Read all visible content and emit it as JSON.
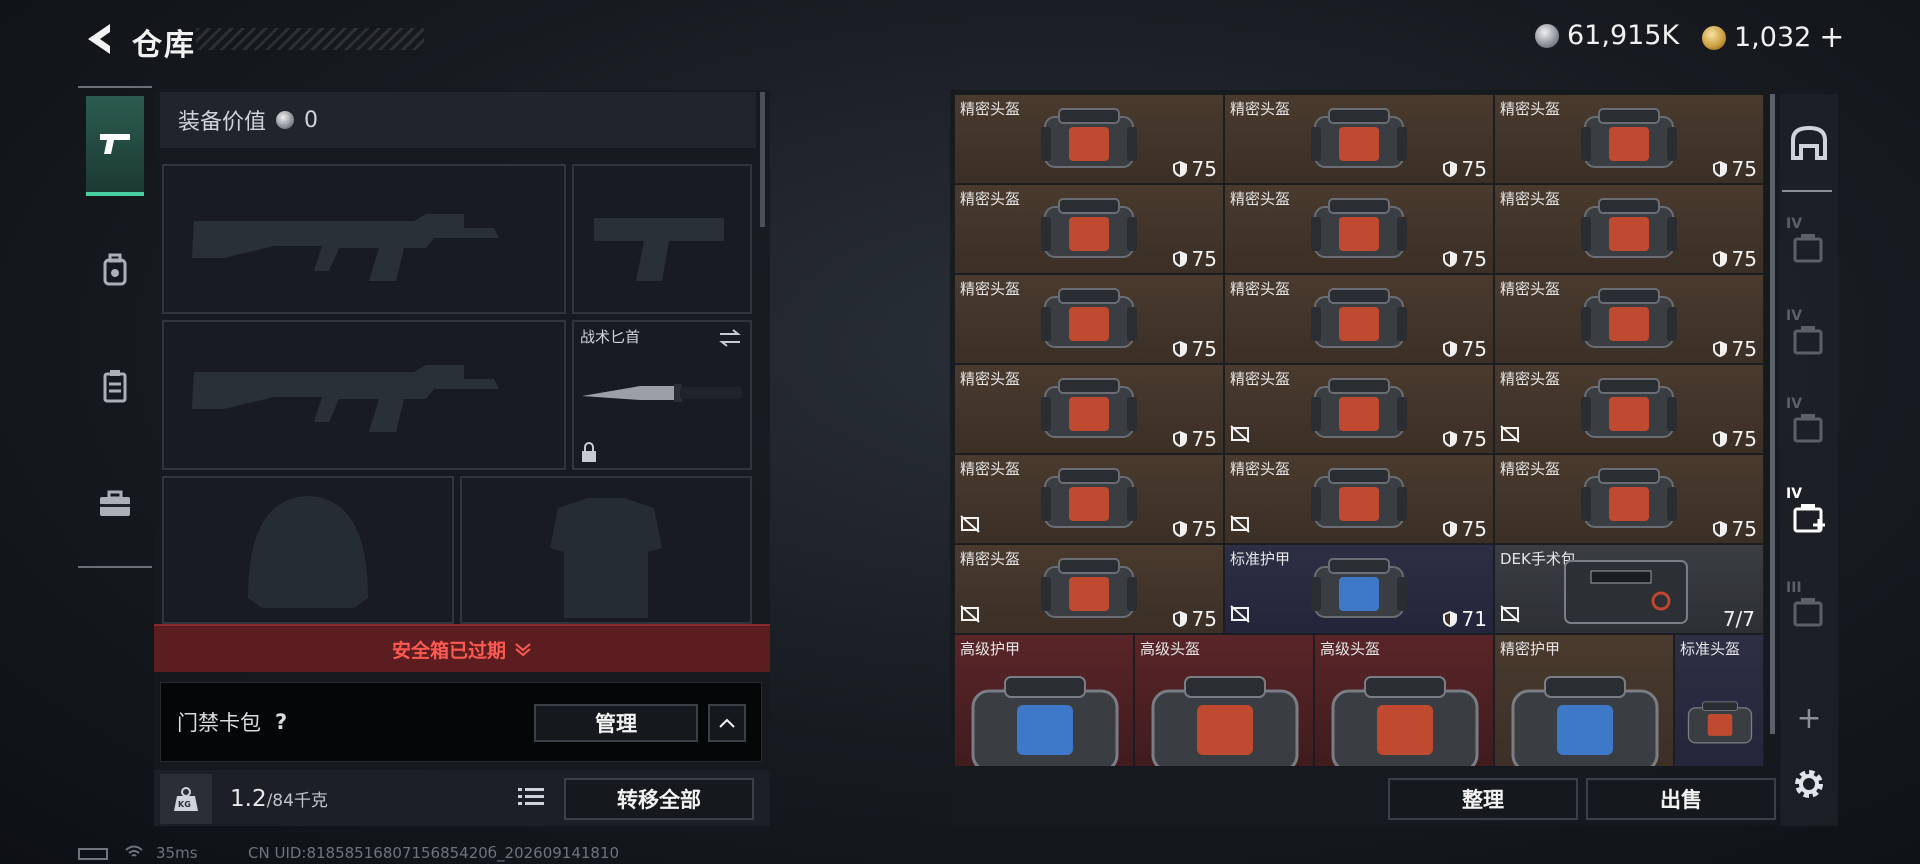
{
  "header": {
    "title": "仓库",
    "silver_amount": "61,915K",
    "gold_amount": "1,032",
    "gold_plus": "+"
  },
  "left": {
    "equip_value_label": "装备价值",
    "equip_value": "0",
    "melee_label": "战术匕首",
    "safebox_text": "安全箱已过期",
    "keycard_label": "门禁卡包",
    "keycard_help": "?",
    "manage_label": "管理",
    "weight_icon_text": "KG",
    "weight_current": "1.2",
    "weight_max": "/84千克",
    "transfer_all_label": "转移全部"
  },
  "inventory": {
    "items": [
      {
        "name": "精密头盔",
        "dur": "75",
        "color": "brown",
        "nosafe": false
      },
      {
        "name": "精密头盔",
        "dur": "75",
        "color": "brown",
        "nosafe": false
      },
      {
        "name": "精密头盔",
        "dur": "75",
        "color": "brown",
        "nosafe": false
      },
      {
        "name": "精密头盔",
        "dur": "75",
        "color": "brown",
        "nosafe": false
      },
      {
        "name": "精密头盔",
        "dur": "75",
        "color": "brown",
        "nosafe": false
      },
      {
        "name": "精密头盔",
        "dur": "75",
        "color": "brown",
        "nosafe": false
      },
      {
        "name": "精密头盔",
        "dur": "75",
        "color": "brown",
        "nosafe": false
      },
      {
        "name": "精密头盔",
        "dur": "75",
        "color": "brown",
        "nosafe": false
      },
      {
        "name": "精密头盔",
        "dur": "75",
        "color": "brown",
        "nosafe": false
      },
      {
        "name": "精密头盔",
        "dur": "75",
        "color": "brown",
        "nosafe": false
      },
      {
        "name": "精密头盔",
        "dur": "75",
        "color": "brown",
        "nosafe": true
      },
      {
        "name": "精密头盔",
        "dur": "75",
        "color": "brown",
        "nosafe": true
      },
      {
        "name": "精密头盔",
        "dur": "75",
        "color": "brown",
        "nosafe": true
      },
      {
        "name": "精密头盔",
        "dur": "75",
        "color": "brown",
        "nosafe": true
      },
      {
        "name": "精密头盔",
        "dur": "75",
        "color": "brown",
        "nosafe": false
      },
      {
        "name": "精密头盔",
        "dur": "75",
        "color": "brown",
        "nosafe": true
      },
      {
        "name": "标准护甲",
        "dur": "71",
        "color": "blue",
        "nosafe": true
      },
      {
        "name": "DEK手术包",
        "count": "7/7",
        "color": "gray",
        "nosafe": true
      }
    ],
    "bottom_row": [
      {
        "name": "高级护甲",
        "color": "red"
      },
      {
        "name": "高级头盔",
        "color": "red"
      },
      {
        "name": "高级头盔",
        "color": "red"
      },
      {
        "name": "精密护甲",
        "color": "brown"
      },
      {
        "name": "标准头盔",
        "color": "blue"
      }
    ],
    "sort_label": "整理",
    "sell_label": "出售"
  },
  "sidebar": {
    "tabs": [
      "IV",
      "IV",
      "IV",
      "IV",
      "III"
    ],
    "add_label": "+"
  },
  "status": {
    "ping": "35ms",
    "uid": "CN UID:8185851680715685420б_202609141810"
  },
  "colors": {
    "safebox_red": "#ff5a52",
    "active_tab": "#4ad0a0",
    "cell_brown": "#4a3a2e",
    "cell_blue": "#2d2f44",
    "cell_red": "#5a2528"
  }
}
